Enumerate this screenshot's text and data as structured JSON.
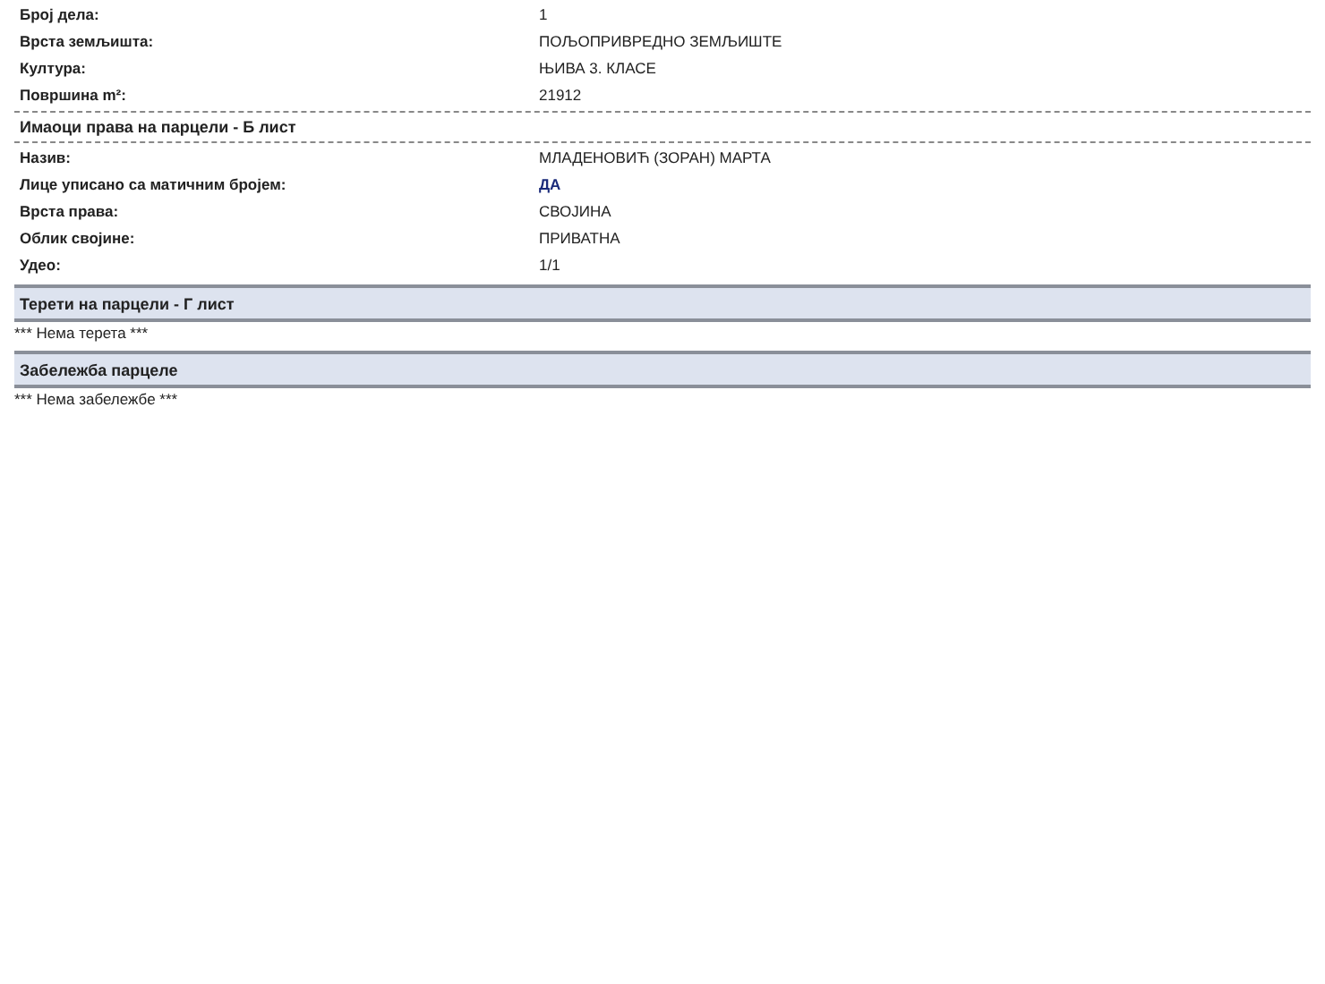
{
  "parcel_rows": [
    {
      "label": "Број дела:",
      "value": "1"
    },
    {
      "label": "Врста земљишта:",
      "value": "ПОЉОПРИВРЕДНО ЗЕМЉИШТЕ"
    },
    {
      "label": "Култура:",
      "value": "ЊИВА 3. КЛАСЕ"
    },
    {
      "label": "Површина m²:",
      "value": "21912"
    }
  ],
  "sections": [
    {
      "title": "Имаоци права на парцели - Б лист",
      "kind": "dashed",
      "rows": [
        {
          "label": "Назив:",
          "value": "МЛАДЕНОВИЋ (ЗОРАН) МАРТА",
          "highlighted": false
        },
        {
          "label": "Лице уписано са матичним бројем:",
          "value": "ДА",
          "highlighted": true
        },
        {
          "label": "Врста права:",
          "value": "СВОЈИНА",
          "highlighted": false
        },
        {
          "label": "Облик својине:",
          "value": "ПРИВАТНА",
          "highlighted": false
        },
        {
          "label": "Удео:",
          "value": "1/1",
          "highlighted": false
        }
      ]
    },
    {
      "title": "Терети на парцели - Г лист",
      "kind": "shaded",
      "note": "*** Нема терета ***"
    },
    {
      "title": "Забележба парцеле",
      "kind": "shaded",
      "note": "*** Нема забележбе ***"
    }
  ]
}
